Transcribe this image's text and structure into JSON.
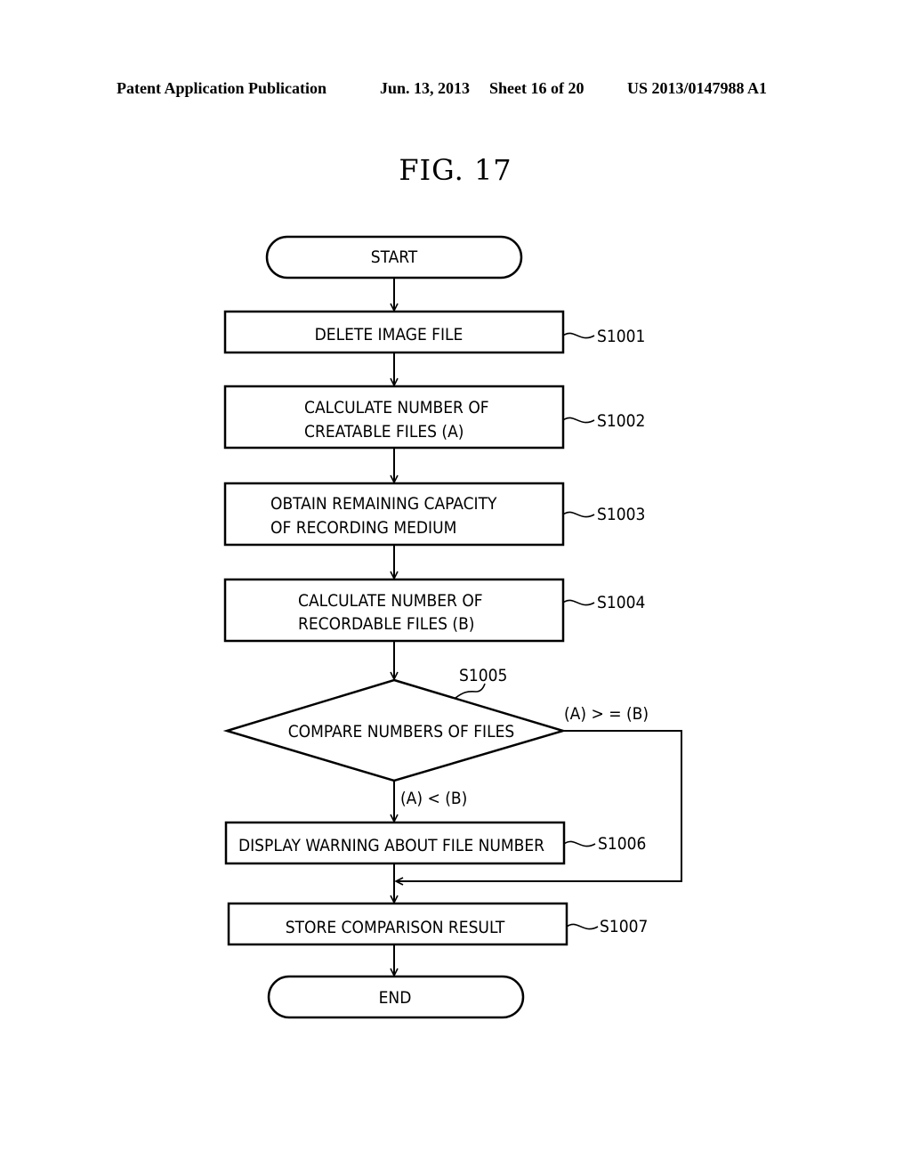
{
  "header": {
    "publication": "Patent Application Publication",
    "date": "Jun. 13, 2013",
    "sheet": "Sheet 16 of 20",
    "patent_number": "US 2013/0147988 A1"
  },
  "figure": {
    "title": "FIG. 17"
  },
  "flowchart": {
    "start": "START",
    "end": "END",
    "steps": [
      {
        "id": "S1001",
        "lines": [
          "DELETE IMAGE FILE"
        ]
      },
      {
        "id": "S1002",
        "lines": [
          "CALCULATE NUMBER OF",
          "CREATABLE FILES (A)"
        ]
      },
      {
        "id": "S1003",
        "lines": [
          "OBTAIN REMAINING CAPACITY",
          "OF RECORDING MEDIUM"
        ]
      },
      {
        "id": "S1004",
        "lines": [
          "CALCULATE NUMBER OF",
          "RECORDABLE FILES (B)"
        ]
      },
      {
        "id": "S1006",
        "lines": [
          "DISPLAY WARNING ABOUT FILE NUMBER"
        ]
      },
      {
        "id": "S1007",
        "lines": [
          "STORE COMPARISON RESULT"
        ]
      }
    ],
    "decision": {
      "id": "S1005",
      "label": "COMPARE NUMBERS OF FILES",
      "branch_yes": "(A) < (B)",
      "branch_no": "(A) > = (B)"
    }
  }
}
